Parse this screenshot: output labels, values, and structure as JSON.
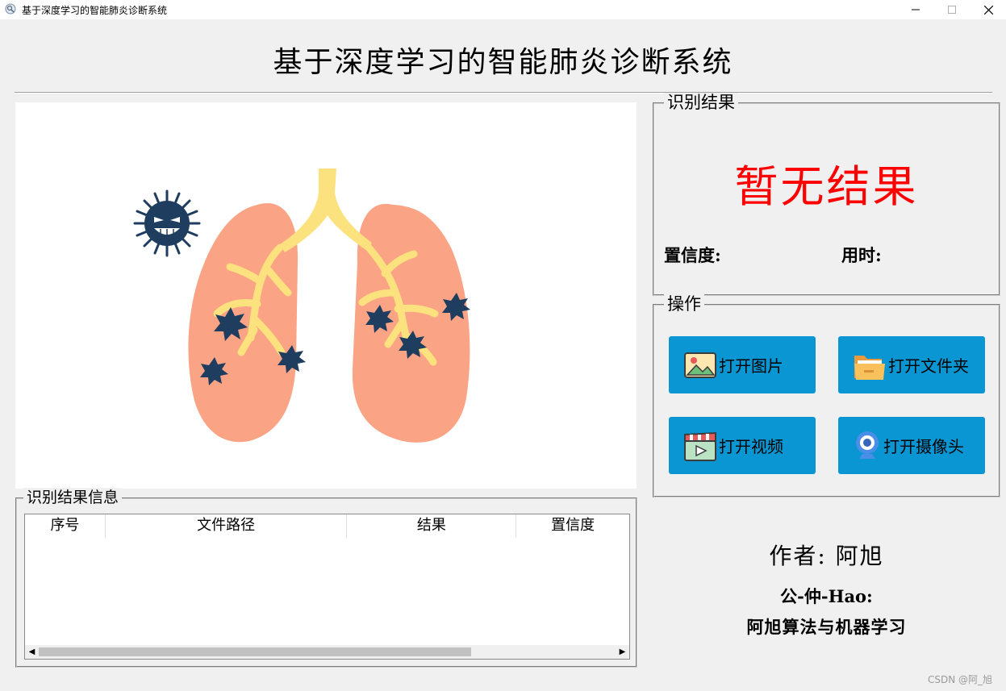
{
  "window": {
    "title": "基于深度学习的智能肺炎诊断系统"
  },
  "header": {
    "title": "基于深度学习的智能肺炎诊断系统"
  },
  "result_panel": {
    "legend": "识别结果",
    "result": "暂无结果",
    "confidence_label": "置信度:",
    "time_label": "用时:",
    "result_color": "#ff0000"
  },
  "operations": {
    "legend": "操作",
    "open_image": "打开图片",
    "open_folder": "打开文件夹",
    "open_video": "打开视频",
    "open_camera": "打开摄像头",
    "button_color": "#0a96d2"
  },
  "results_table": {
    "legend": "识别结果信息",
    "columns": [
      "序号",
      "文件路径",
      "结果",
      "置信度"
    ],
    "rows": []
  },
  "author": {
    "name": "作者: 阿旭",
    "public_label": "公-仲-Hao:",
    "public_name": "阿旭算法与机器学习"
  },
  "watermark": "CSDN @阿_旭",
  "icons": [
    "app-icon",
    "minimize-icon",
    "maximize-icon",
    "close-icon",
    "picture-icon",
    "folder-icon",
    "video-clapper-icon",
    "webcam-icon",
    "scroll-left-icon",
    "scroll-right-icon"
  ]
}
